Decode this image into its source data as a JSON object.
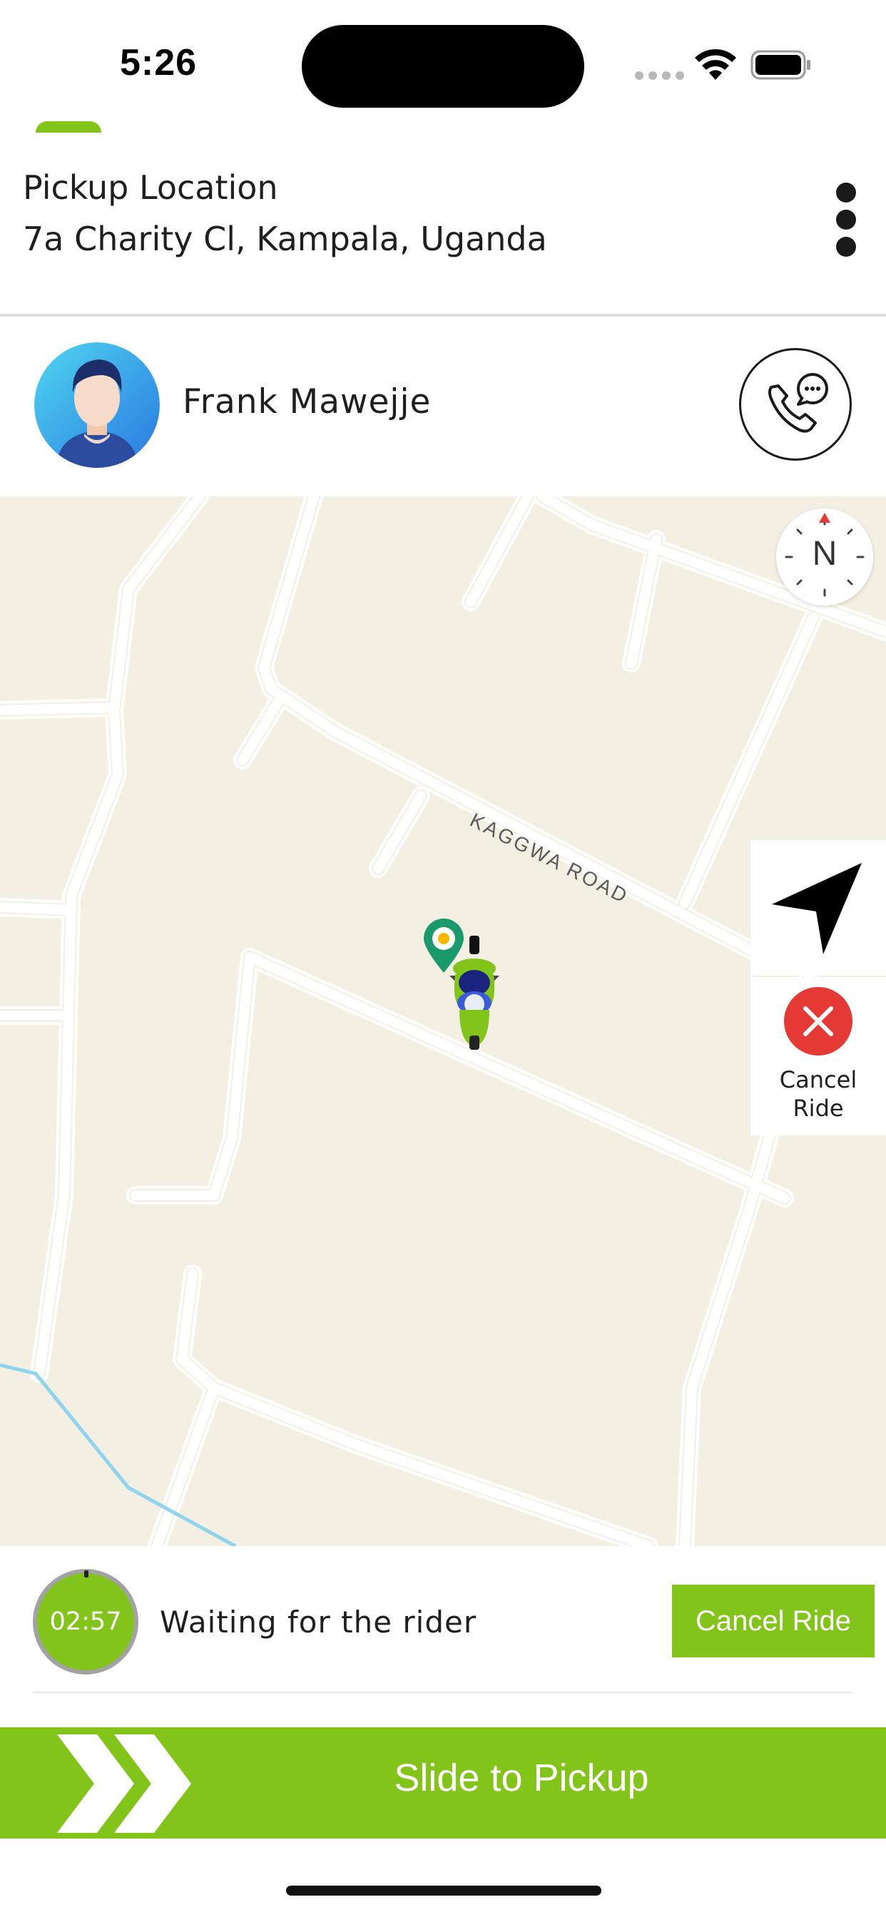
{
  "status_bar": {
    "time": "5:26"
  },
  "pickup": {
    "title": "Pickup Location",
    "address": "7a Charity Cl, Kampala, Uganda"
  },
  "driver": {
    "name": "Frank Mawejje"
  },
  "map": {
    "road_label": "KAGGWA ROAD",
    "compass_label": "N",
    "cancel_label": "Cancel\nRide"
  },
  "waiting": {
    "timer": "02:57",
    "message": "Waiting for the rider",
    "cancel_button": "Cancel Ride"
  },
  "slider": {
    "label": "Slide to Pickup"
  },
  "colors": {
    "accent": "#82c419",
    "cancel_red": "#e53935",
    "pin_teal": "#1a9a6c",
    "map_bg": "#f3efe3"
  },
  "icons": [
    "wifi-icon",
    "battery-icon",
    "more-vertical-icon",
    "avatar",
    "phone-chat-icon",
    "compass-icon",
    "navigation-arrow-icon",
    "close-circle-icon",
    "location-pin-icon",
    "motorbike-icon",
    "double-chevron-right-icon"
  ]
}
